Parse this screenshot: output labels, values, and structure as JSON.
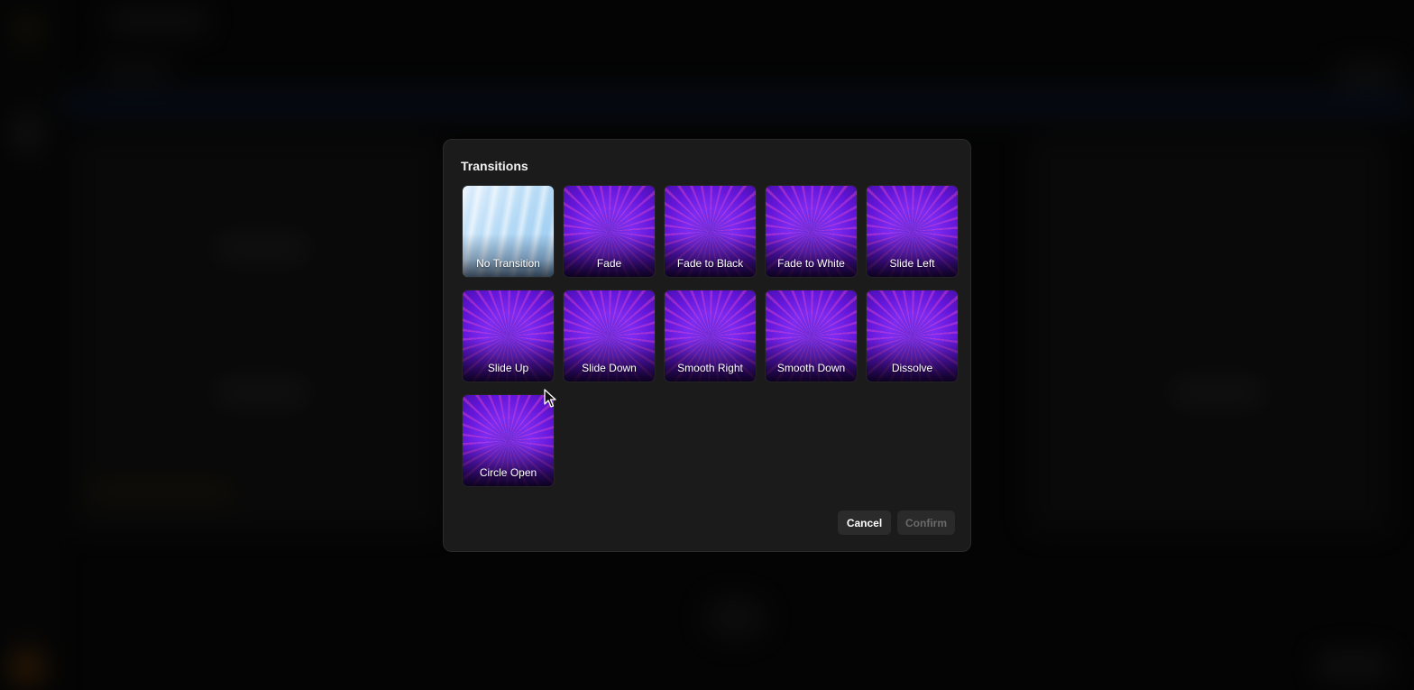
{
  "dialog": {
    "title": "Transitions",
    "transitions": [
      {
        "label": "No Transition"
      },
      {
        "label": "Fade"
      },
      {
        "label": "Fade to Black"
      },
      {
        "label": "Fade to White"
      },
      {
        "label": "Slide Left"
      },
      {
        "label": "Slide Up"
      },
      {
        "label": "Slide Down"
      },
      {
        "label": "Smooth Right"
      },
      {
        "label": "Smooth Down"
      },
      {
        "label": "Dissolve"
      },
      {
        "label": "Circle Open"
      }
    ],
    "cancel_label": "Cancel",
    "confirm_label": "Confirm"
  },
  "colors": {
    "dialog_bg": "#1b1b1b",
    "tile_purple": "#7b2cf0",
    "tile_none": "#b8dcf6",
    "confirm_disabled_text": "#6a6a6a"
  },
  "icons": {
    "cursor": "arrow-cursor-icon"
  }
}
